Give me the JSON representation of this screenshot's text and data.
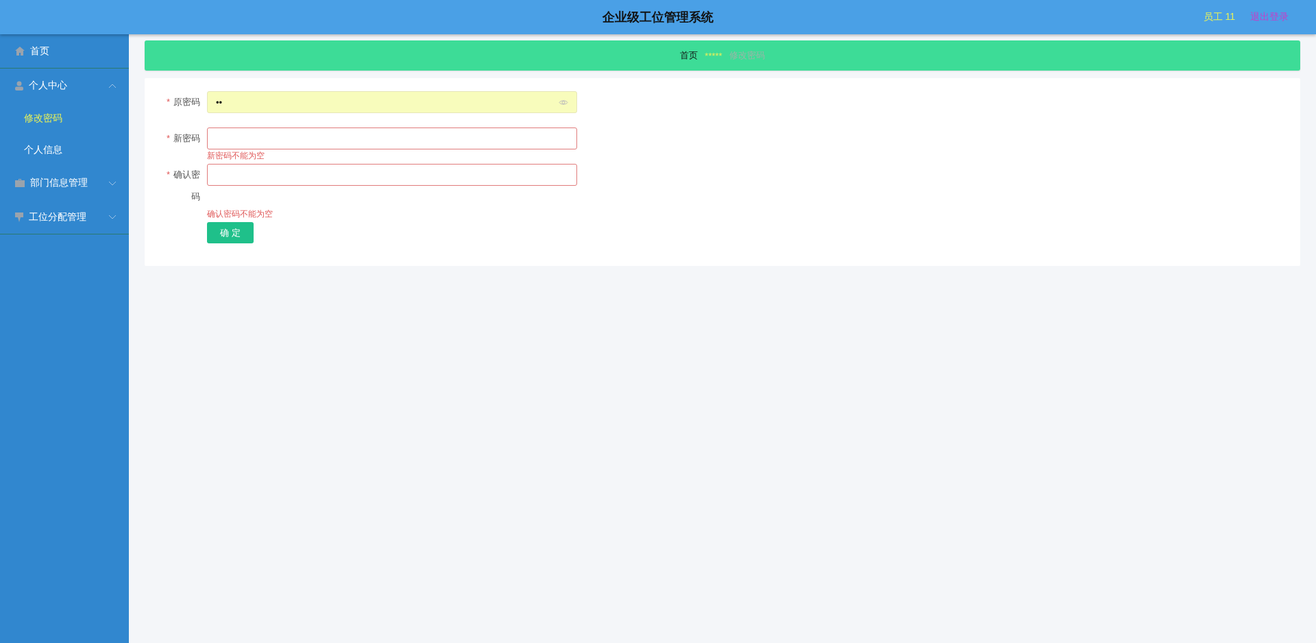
{
  "header": {
    "title": "企业级工位管理系统",
    "user": "员工 11",
    "logout": "退出登录"
  },
  "sidebar": {
    "items": [
      {
        "label": "首页",
        "kind": "link",
        "selected": false
      },
      {
        "label": "个人中心",
        "kind": "group",
        "expanded": true,
        "children": [
          {
            "label": "修改密码",
            "selected": true
          },
          {
            "label": "个人信息",
            "selected": false
          }
        ]
      },
      {
        "label": "部门信息管理",
        "kind": "group",
        "expanded": false
      },
      {
        "label": "工位分配管理",
        "kind": "group",
        "expanded": false
      }
    ]
  },
  "breadcrumb": [
    {
      "label": "首页"
    },
    {
      "label": "*****",
      "kind": "separator"
    },
    {
      "label": "修改密码"
    }
  ],
  "form": {
    "fields": [
      {
        "label": "原密码",
        "required_mark": "*",
        "value": "••",
        "filled": true
      },
      {
        "label": "新密码",
        "required_mark": "*",
        "filled": false,
        "error": "新密码不能为空"
      },
      {
        "label": "确认密码",
        "required_mark": "*",
        "filled": false,
        "error": "确认密码不能为空"
      }
    ],
    "submit": "确 定"
  }
}
